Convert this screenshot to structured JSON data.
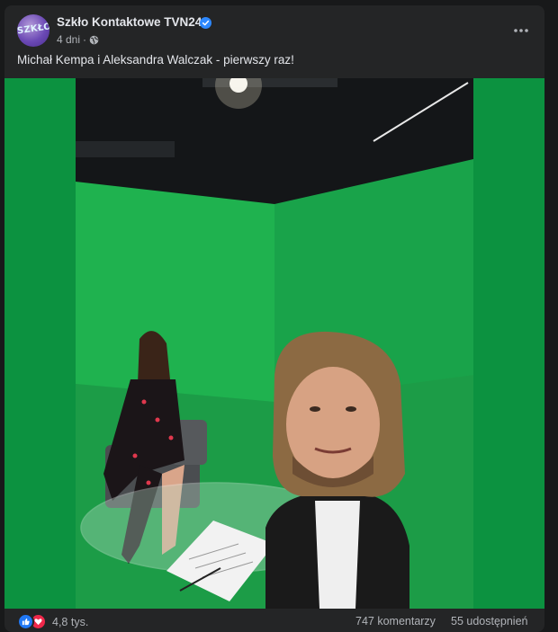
{
  "post": {
    "page_name": "Szkło Kontaktowe TVN24",
    "avatar_text": "SZKŁO",
    "time": "4 dni",
    "separator": "·",
    "privacy_icon": "globe-icon",
    "verified_icon": "verified-badge-icon",
    "more_icon": "more-options-icon",
    "caption": "Michał Kempa i Aleksandra Walczak - pierwszy raz!"
  },
  "photo": {
    "subject": "Two people in green-screen TV studio"
  },
  "footer": {
    "reaction_icons": [
      "like-icon",
      "love-icon"
    ],
    "reaction_count": "4,8 tys.",
    "comments": "747 komentarzy",
    "shares": "55 udostępnień"
  },
  "colors": {
    "background": "#18191a",
    "card": "#242526",
    "text_primary": "#e4e6eb",
    "text_secondary": "#b0b3b8",
    "verified": "#2d88ff",
    "like": "#2078f4",
    "love": "#f0284a",
    "green_screen": "#0b8f3f"
  }
}
